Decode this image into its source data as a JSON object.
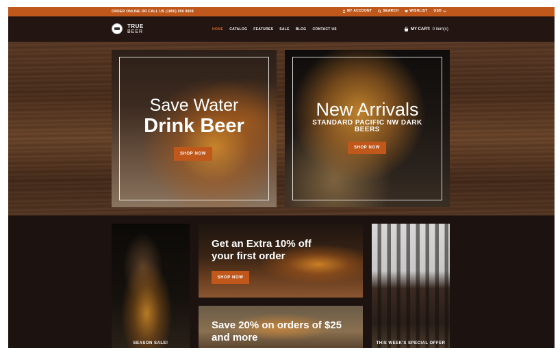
{
  "topbar": {
    "promo": "ORDER ONLINE OR CALL US (1800) 000 8808",
    "links": [
      {
        "label": "MY ACCOUNT",
        "icon": "user-icon"
      },
      {
        "label": "SEARCH",
        "icon": "search-icon"
      },
      {
        "label": "WISHLIST",
        "icon": "heart-icon"
      }
    ],
    "currency": "USD"
  },
  "header": {
    "logo_line1": "TRUE",
    "logo_line2": "BEER",
    "nav": [
      "HOME",
      "CATALOG",
      "FEATURES",
      "SALE",
      "BLOG",
      "CONTACT US"
    ],
    "cart_label": "MY CART:",
    "cart_count": "0 item(s)"
  },
  "hero": {
    "left": {
      "line1": "Save Water",
      "line2": "Drink Beer",
      "button": "SHOP NOW"
    },
    "right": {
      "line1": "New Arrivals",
      "line2": "STANDARD PACIFIC NW DARK BEERS",
      "button": "SHOP NOW"
    }
  },
  "promos": {
    "season": {
      "caption": "SEASON SALE!"
    },
    "extra": {
      "heading": "Get an Extra 10% off your first order",
      "button": "SHOP NOW"
    },
    "save": {
      "heading": "Save 20% on orders of $25 and more"
    },
    "special": {
      "caption": "THIS WEEK'S SPECIAL OFFER"
    }
  },
  "colors": {
    "accent": "#c0571b",
    "header_bg": "#221512",
    "active_nav": "#d26a2a"
  }
}
